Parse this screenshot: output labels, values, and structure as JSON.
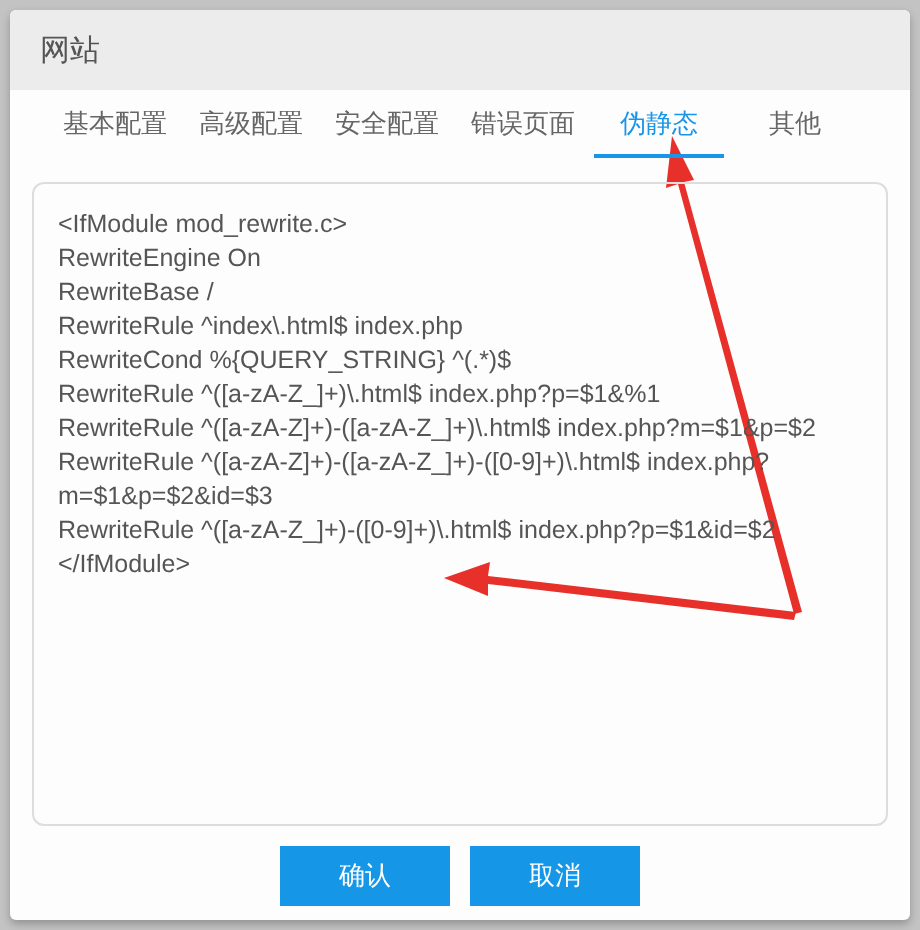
{
  "window": {
    "title": "网站"
  },
  "tabs": [
    {
      "label": "基本配置",
      "selected": false
    },
    {
      "label": "高级配置",
      "selected": false
    },
    {
      "label": "安全配置",
      "selected": false
    },
    {
      "label": "错误页面",
      "selected": false
    },
    {
      "label": "伪静态",
      "selected": true
    },
    {
      "label": "其他",
      "selected": false
    }
  ],
  "rewrite_rules": {
    "value": "<IfModule mod_rewrite.c>\nRewriteEngine On\nRewriteBase /\nRewriteRule ^index\\.html$ index.php\nRewriteCond %{QUERY_STRING} ^(.*)$\nRewriteRule ^([a-zA-Z_]+)\\.html$ index.php?p=$1&%1\nRewriteRule ^([a-zA-Z]+)-([a-zA-Z_]+)\\.html$ index.php?m=$1&p=$2\nRewriteRule ^([a-zA-Z]+)-([a-zA-Z_]+)-([0-9]+)\\.html$ index.php?m=$1&p=$2&id=$3\nRewriteRule ^([a-zA-Z_]+)-([0-9]+)\\.html$ index.php?p=$1&id=$2\n</IfModule>"
  },
  "buttons": [
    {
      "label": "确认",
      "kind": "primary"
    },
    {
      "label": "取消",
      "kind": "primary"
    }
  ]
}
